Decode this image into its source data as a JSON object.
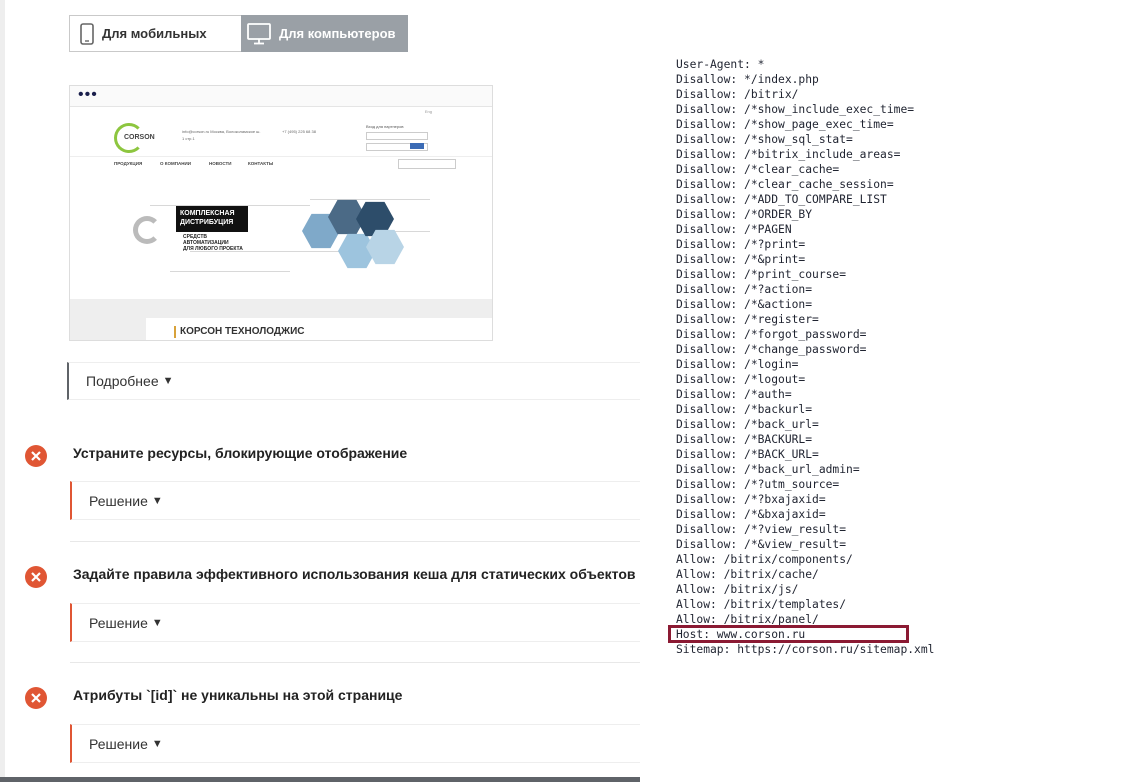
{
  "device_toggle": {
    "mobile_label": "Для мобильных",
    "desktop_label": "Для компьютеров",
    "selected": "desktop"
  },
  "preview": {
    "lang": "Eng",
    "logo": "CORSON",
    "contact": "info@corson.ru Москва, Волоколамское ш. 1 стр.1",
    "phone": "+7 (495) 225 68 38",
    "login_title": "Вход для партнеров",
    "nav": [
      "ПРОДУКЦИЯ",
      "О КОМПАНИИ",
      "НОВОСТИ",
      "КОНТАКТЫ"
    ],
    "search_placeholder": "Поиск",
    "hero_title_1": "КОМПЛЕКСНАЯ",
    "hero_title_2": "ДИСТРИБУЦИЯ",
    "hero_sub_1": "СРЕДСТВ",
    "hero_sub_2": "АВТОМАТИЗАЦИИ",
    "hero_sub_3": "ДЛЯ ЛЮБОГО ПРОЕКТА",
    "company_name": "КОРСОН ТЕХНОЛОДЖИС"
  },
  "details": {
    "label": "Подробнее",
    "arrow": "▼"
  },
  "audits": [
    {
      "title": "Устраните ресурсы, блокирующие отображение",
      "solution": "Решение",
      "arrow": "▼"
    },
    {
      "title": "Задайте правила эффективного использования кеша для статических объектов",
      "solution": "Решение",
      "arrow": "▼"
    },
    {
      "title": "Атрибуты `[id]` не уникальны на этой странице",
      "solution": "Решение",
      "arrow": "▼"
    }
  ],
  "robots_lines": [
    "User-Agent: *",
    "Disallow: */index.php",
    "Disallow: /bitrix/",
    "Disallow: /*show_include_exec_time=",
    "Disallow: /*show_page_exec_time=",
    "Disallow: /*show_sql_stat=",
    "Disallow: /*bitrix_include_areas=",
    "Disallow: /*clear_cache=",
    "Disallow: /*clear_cache_session=",
    "Disallow: /*ADD_TO_COMPARE_LIST",
    "Disallow: /*ORDER_BY",
    "Disallow: /*PAGEN",
    "Disallow: /*?print=",
    "Disallow: /*&print=",
    "Disallow: /*print_course=",
    "Disallow: /*?action=",
    "Disallow: /*&action=",
    "Disallow: /*register=",
    "Disallow: /*forgot_password=",
    "Disallow: /*change_password=",
    "Disallow: /*login=",
    "Disallow: /*logout=",
    "Disallow: /*auth=",
    "Disallow: /*backurl=",
    "Disallow: /*back_url=",
    "Disallow: /*BACKURL=",
    "Disallow: /*BACK_URL=",
    "Disallow: /*back_url_admin=",
    "Disallow: /*?utm_source=",
    "Disallow: /*?bxajaxid=",
    "Disallow: /*&bxajaxid=",
    "Disallow: /*?view_result=",
    "Disallow: /*&view_result=",
    "Allow: /bitrix/components/",
    "Allow: /bitrix/cache/",
    "Allow: /bitrix/js/",
    "Allow: /bitrix/templates/",
    "Allow: /bitrix/panel/",
    "Host: www.corson.ru",
    "Sitemap: https://corson.ru/sitemap.xml"
  ],
  "colors": {
    "error": "#e05634",
    "highlight": "#8b1a33",
    "toggle_active": "#9aa0a6"
  }
}
